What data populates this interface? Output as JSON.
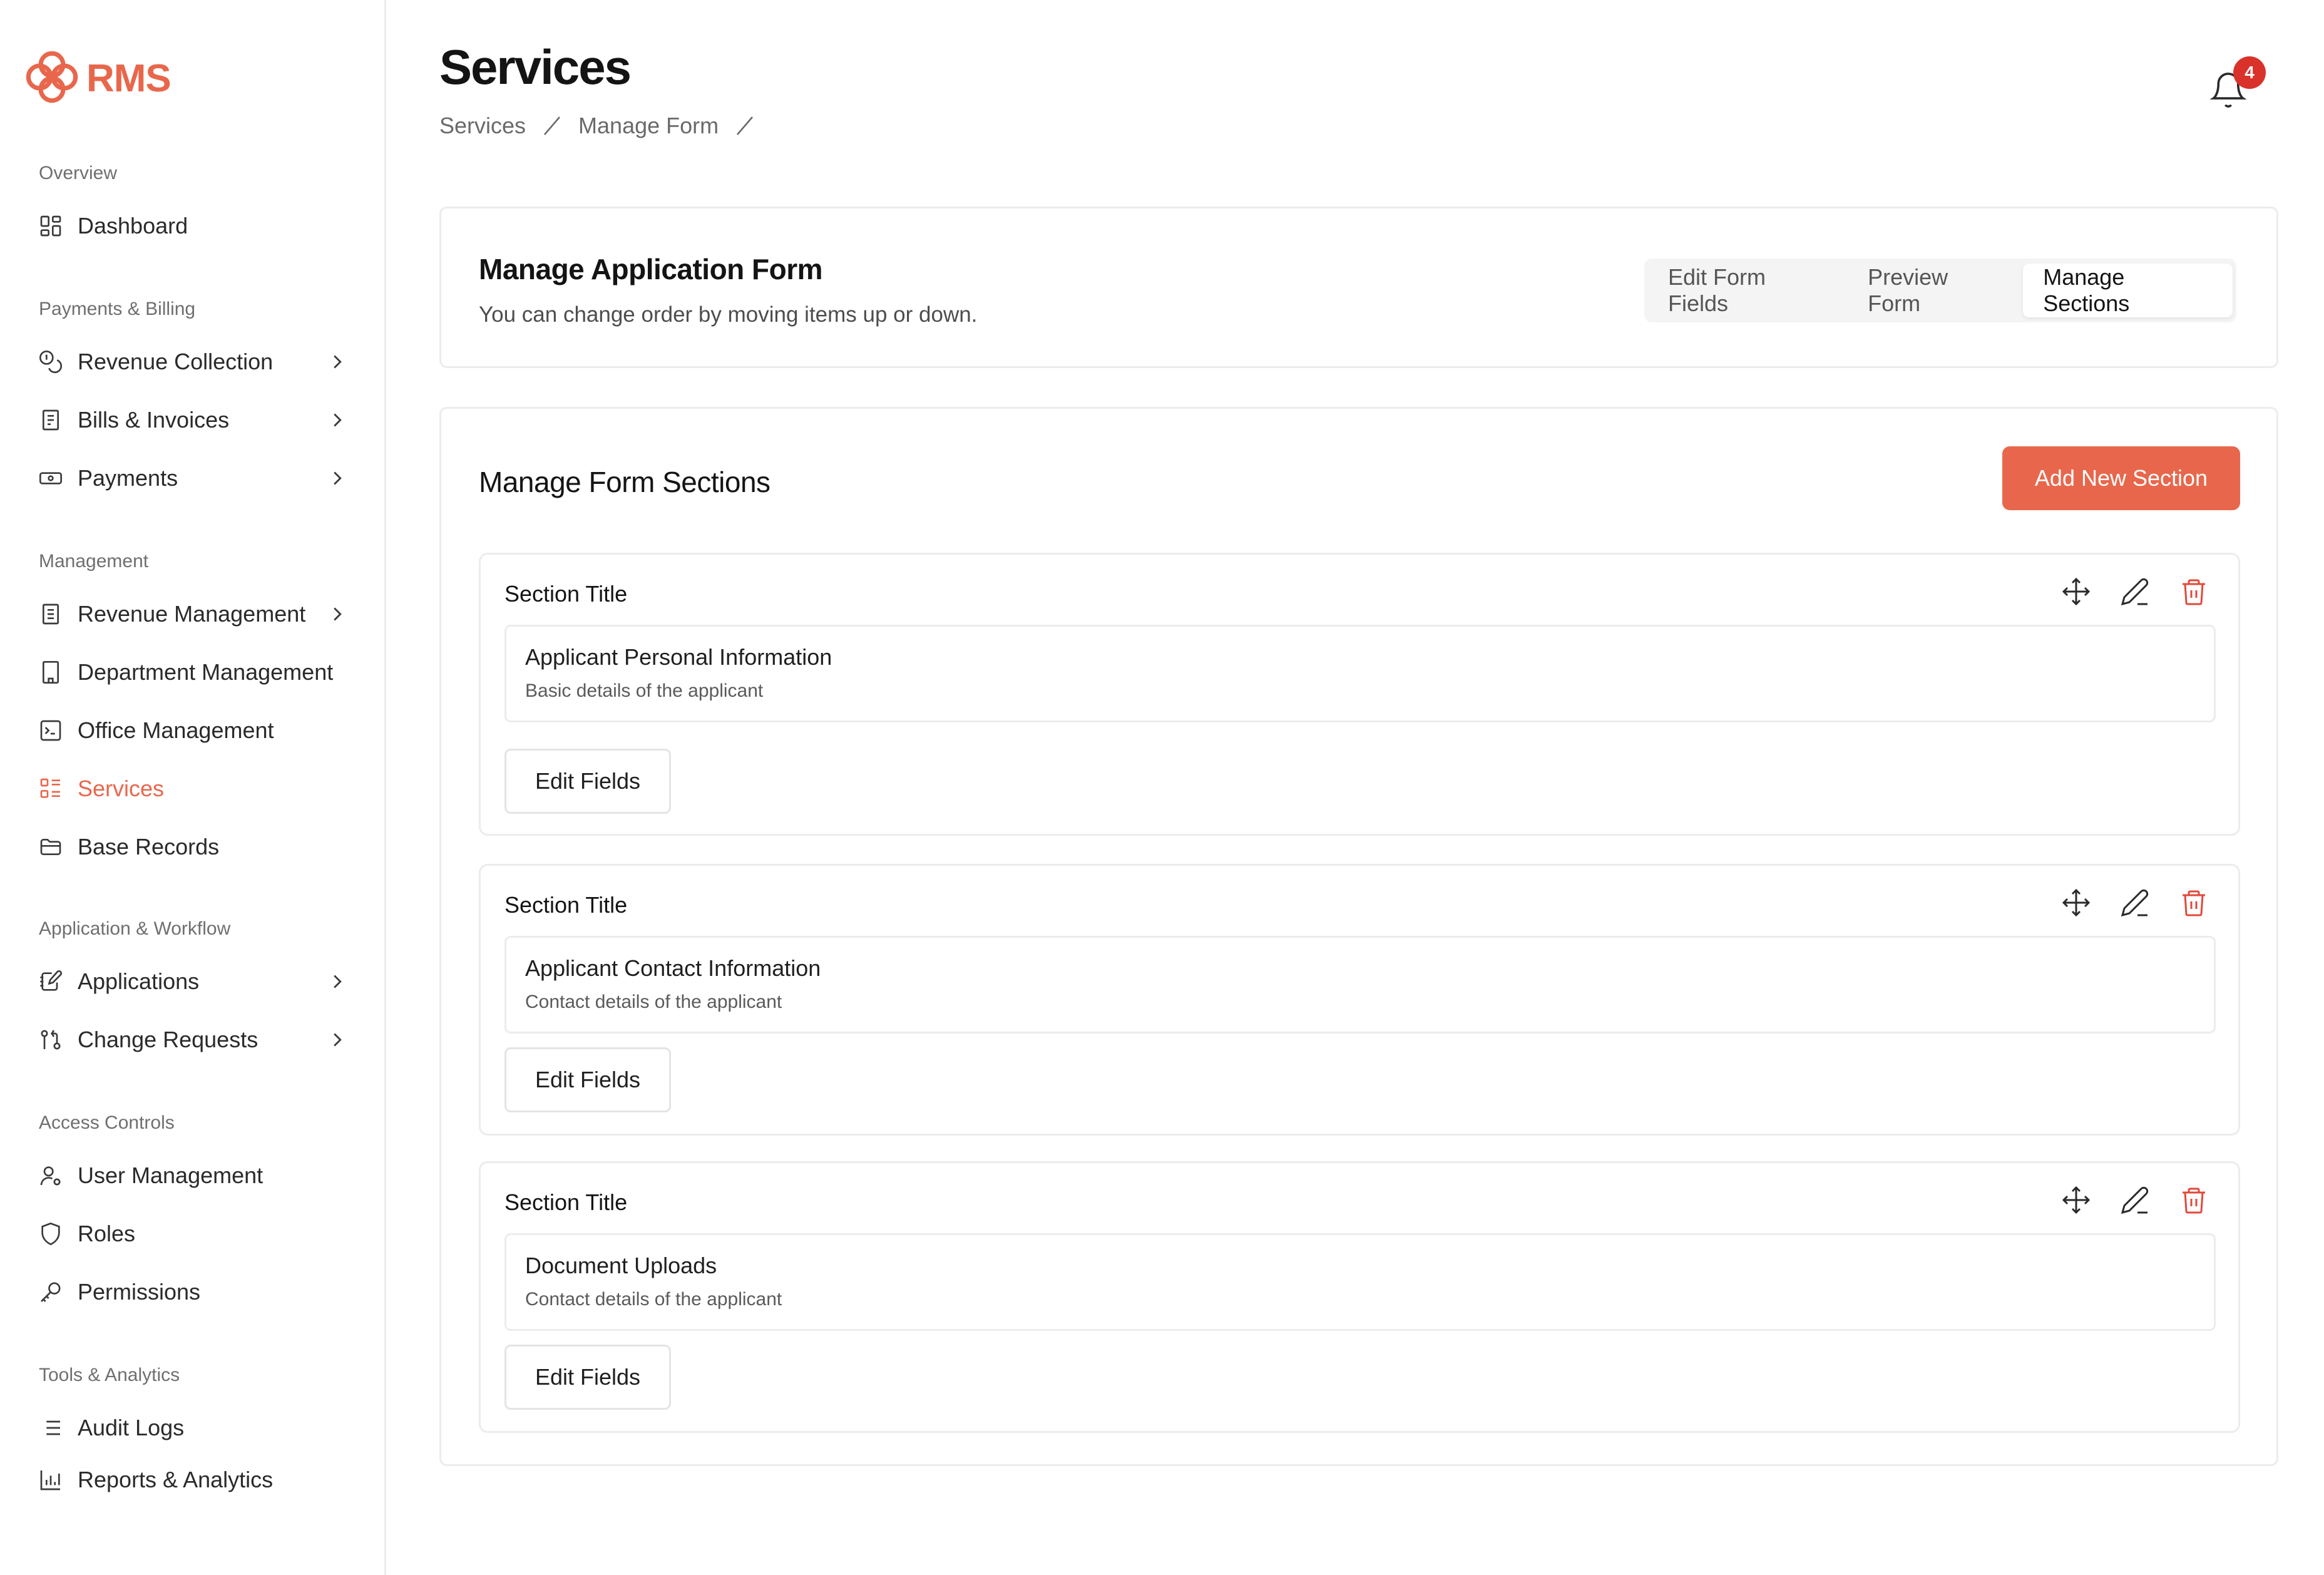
{
  "app": {
    "name": "RMS",
    "accent": "#e8674c"
  },
  "sidebar": {
    "groups": [
      {
        "heading": "Overview",
        "items": [
          {
            "label": "Dashboard",
            "icon": "dashboard-grid-icon"
          }
        ]
      },
      {
        "heading": "Payments & Billing",
        "items": [
          {
            "label": "Revenue Collection",
            "icon": "coins-icon",
            "expandable": true
          },
          {
            "label": "Bills & Invoices",
            "icon": "receipt-icon",
            "expandable": true
          },
          {
            "label": "Payments",
            "icon": "banknote-icon",
            "expandable": true
          }
        ]
      },
      {
        "heading": "Management",
        "items": [
          {
            "label": "Revenue Management",
            "icon": "document-icon",
            "expandable": true
          },
          {
            "label": "Department Management",
            "icon": "building-icon"
          },
          {
            "label": "Office Management",
            "icon": "terminal-icon"
          },
          {
            "label": "Services",
            "icon": "list-grid-icon",
            "active": true
          },
          {
            "label": "Base Records",
            "icon": "folder-icon"
          }
        ]
      },
      {
        "heading": "Application & Workflow",
        "items": [
          {
            "label": "Applications",
            "icon": "notebook-pen-icon",
            "expandable": true
          },
          {
            "label": "Change Requests",
            "icon": "git-pull-request-icon",
            "expandable": true
          }
        ]
      },
      {
        "heading": "Access Controls",
        "items": [
          {
            "label": "User Management",
            "icon": "user-cog-icon"
          },
          {
            "label": "Roles",
            "icon": "shield-icon"
          },
          {
            "label": "Permissions",
            "icon": "key-icon"
          }
        ]
      },
      {
        "heading": "Tools & Analytics",
        "items": [
          {
            "label": "Audit Logs",
            "icon": "list-icon"
          },
          {
            "label": "Reports & Analytics",
            "icon": "bar-chart-icon"
          }
        ]
      }
    ]
  },
  "header": {
    "title": "Services",
    "breadcrumb": [
      "Services",
      "Manage Form"
    ],
    "notifications": {
      "count": "4"
    }
  },
  "form_card": {
    "title": "Manage Application Form",
    "subtitle": "You can change order by moving items up or down.",
    "tabs": [
      {
        "label": "Edit Form Fields"
      },
      {
        "label": "Preview Form"
      },
      {
        "label": "Manage Sections",
        "active": true
      }
    ]
  },
  "sections_card": {
    "title": "Manage Form Sections",
    "add_label": "Add New Section",
    "sections": [
      {
        "label": "Section Title",
        "title": "Applicant Personal Information",
        "description": "Basic details of the applicant",
        "edit_label": "Edit Fields"
      },
      {
        "label": "Section Title",
        "title": "Applicant Contact Information",
        "description": "Contact details of the applicant",
        "edit_label": "Edit Fields"
      },
      {
        "label": "Section Title",
        "title": "Document Uploads",
        "description": "Contact details of the applicant",
        "edit_label": "Edit Fields"
      }
    ]
  }
}
